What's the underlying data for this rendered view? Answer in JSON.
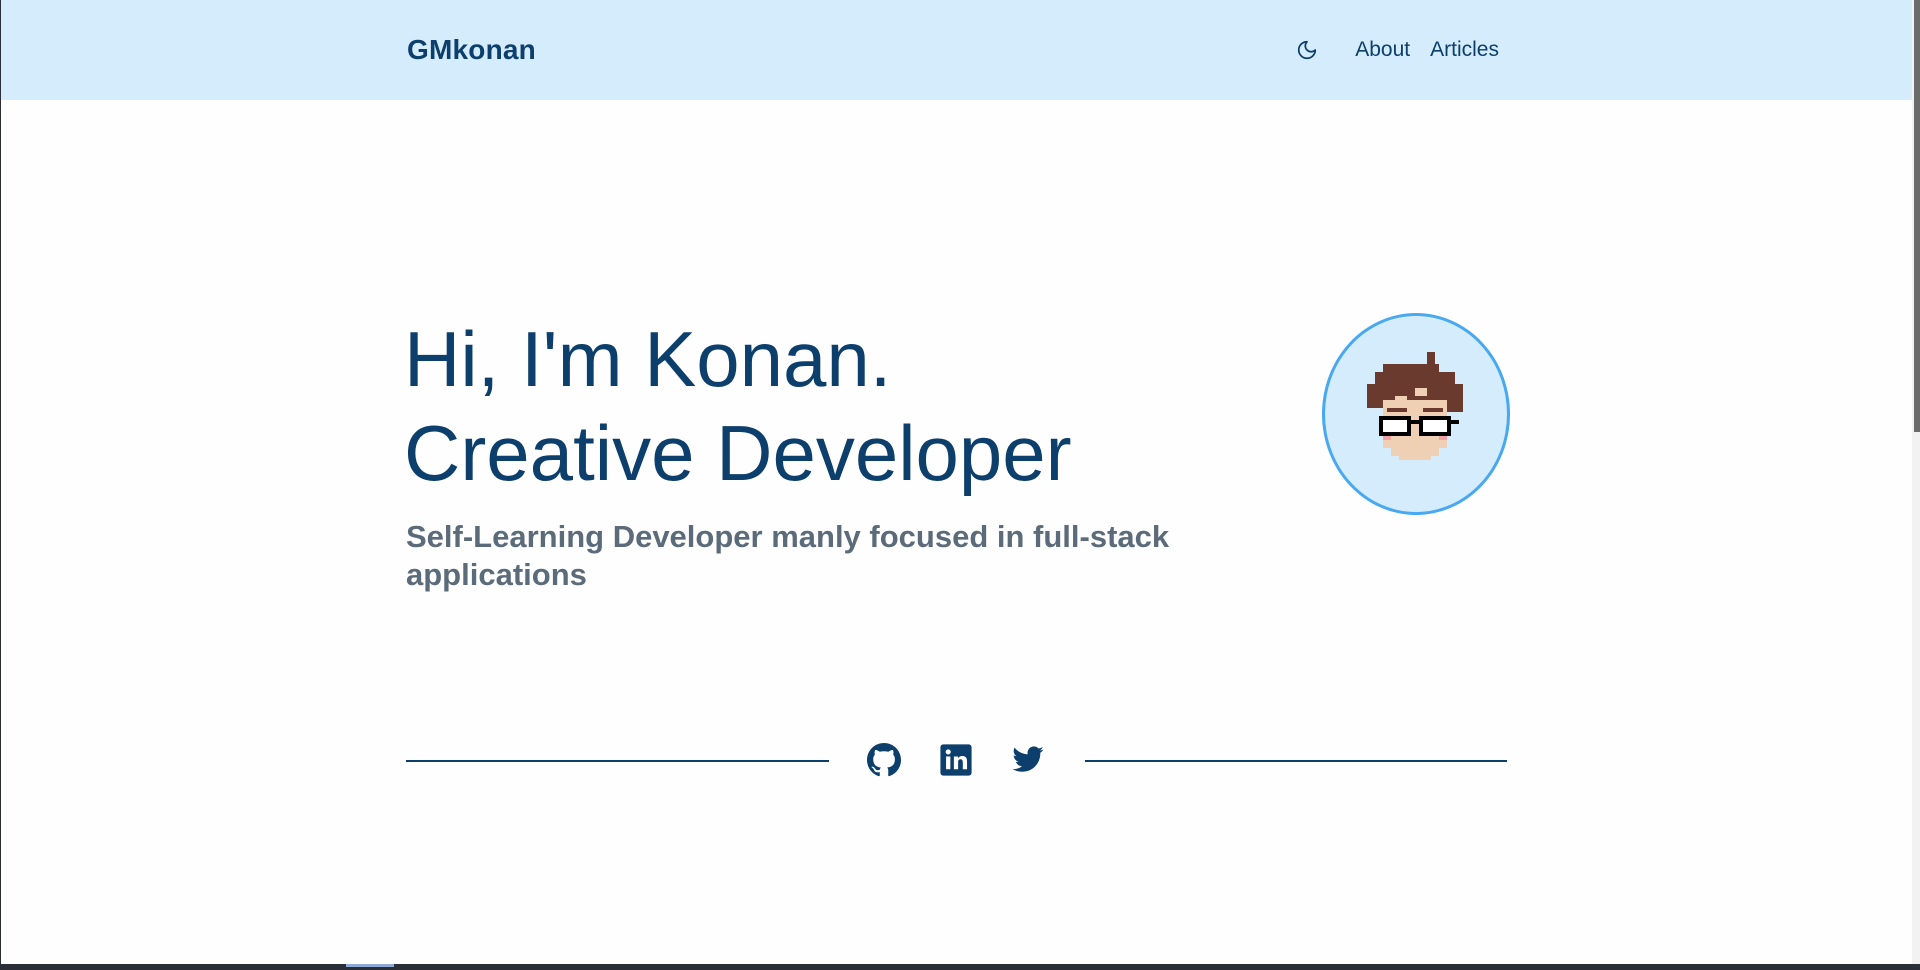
{
  "header": {
    "brand": "GMkonan",
    "nav": {
      "theme_toggle_icon": "moon-icon",
      "about_label": "About",
      "articles_label": "Articles"
    }
  },
  "hero": {
    "greeting": "Hi, I'm Konan.",
    "role": "Creative Developer",
    "subtitle": "Self-Learning Developer manly focused in full-stack applications",
    "avatar_icon": "pixel-avatar-icon"
  },
  "social": {
    "icons": [
      "github-icon",
      "linkedin-icon",
      "twitter-icon"
    ]
  },
  "colors": {
    "header_bg": "#d5ecfd",
    "primary": "#0c3f6b",
    "subtitle": "#5c6b7a",
    "avatar_border": "#48a8f0"
  }
}
